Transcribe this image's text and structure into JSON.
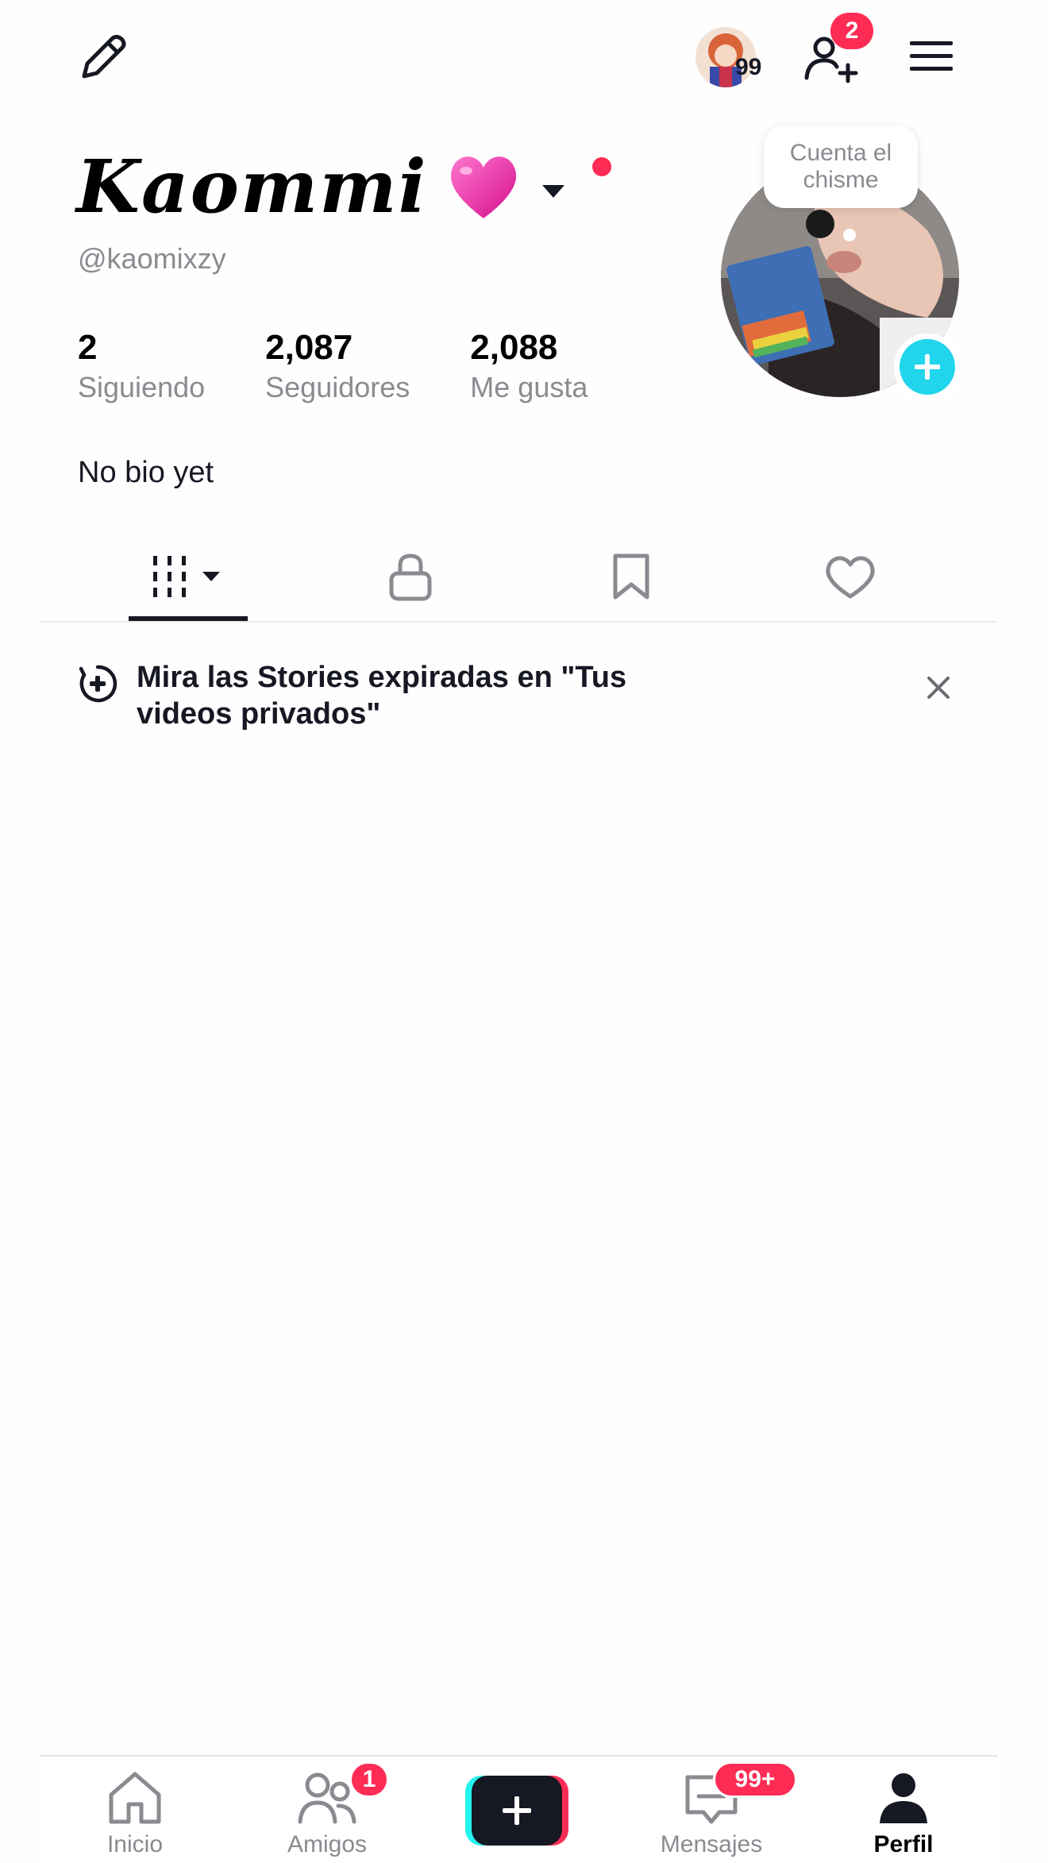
{
  "topbar": {
    "story_count": "99",
    "friend_requests_badge": "2"
  },
  "profile": {
    "display_name": "Kaommi",
    "username": "@kaomixzy",
    "bio": "No bio yet",
    "avatar_bubble": "Cuenta el chisme",
    "stats": [
      {
        "value": "2",
        "label": "Siguiendo"
      },
      {
        "value": "2,087",
        "label": "Seguidores"
      },
      {
        "value": "2,088",
        "label": "Me gusta"
      }
    ]
  },
  "tabs": [
    {
      "icon": "grid-icon",
      "active": true
    },
    {
      "icon": "lock-icon",
      "active": false
    },
    {
      "icon": "bookmark-icon",
      "active": false
    },
    {
      "icon": "heart-outline-icon",
      "active": false
    }
  ],
  "notice": {
    "text": "Mira las Stories expiradas en \"Tus videos privados\""
  },
  "bottom_nav": {
    "home_label": "Inicio",
    "friends_label": "Amigos",
    "friends_badge": "1",
    "messages_label": "Mensajes",
    "messages_badge": "99+",
    "profile_label": "Perfil"
  },
  "colors": {
    "accent_red": "#fe2c55",
    "accent_cyan": "#20d5ec",
    "text_primary": "#161823",
    "text_secondary": "#8a8b91"
  }
}
